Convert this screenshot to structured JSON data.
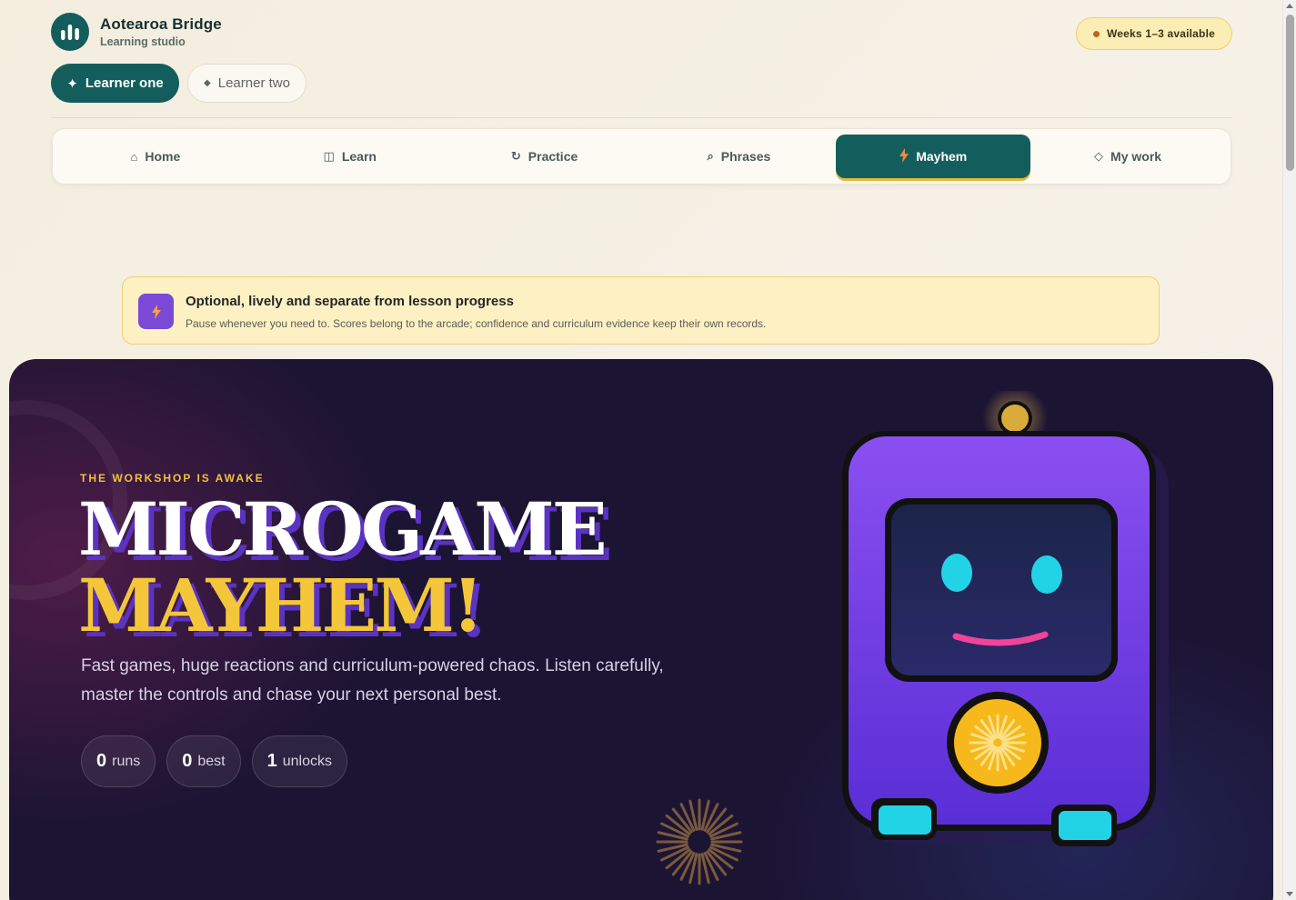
{
  "brand": {
    "title": "Aotearoa Bridge",
    "subtitle": "Learning studio"
  },
  "availability": {
    "label": "Weeks 1–3 available"
  },
  "learners": [
    {
      "label": "Learner one",
      "icon": "sparkle-icon",
      "active": true
    },
    {
      "label": "Learner two",
      "icon": "diamond-icon",
      "active": false
    }
  ],
  "nav": {
    "tabs": [
      {
        "label": "Home",
        "icon": "home-icon",
        "glyph": "⌂"
      },
      {
        "label": "Learn",
        "icon": "book-icon",
        "glyph": "◫"
      },
      {
        "label": "Practice",
        "icon": "refresh-icon",
        "glyph": "↻"
      },
      {
        "label": "Phrases",
        "icon": "search-icon",
        "glyph": "⌕"
      },
      {
        "label": "Mayhem",
        "icon": "bolt-icon",
        "glyph": "ϟ",
        "active": true
      },
      {
        "label": "My work",
        "icon": "diamond-outline-icon",
        "glyph": "◇"
      }
    ]
  },
  "notice": {
    "title": "Optional, lively and separate from lesson progress",
    "body": "Pause whenever you need to. Scores belong to the arcade; confidence and curriculum evidence keep their own records."
  },
  "hero": {
    "eyebrow": "THE WORKSHOP IS AWAKE",
    "headline_line1": "MICROGAME",
    "headline_line2": "MAYHEM!",
    "description": "Fast games, huge reactions and curriculum-powered chaos. Listen carefully, master the controls and chase your next personal best.",
    "stats": [
      {
        "value": "0",
        "label": "runs"
      },
      {
        "value": "0",
        "label": "best"
      },
      {
        "value": "1",
        "label": "unlocks"
      }
    ]
  },
  "colors": {
    "brand_teal": "#135e5c",
    "accent_gold": "#f4c73a",
    "hero_bg": "#1c1433",
    "robot_purple": "#6b3fe0",
    "eye_cyan": "#22d3e6"
  }
}
